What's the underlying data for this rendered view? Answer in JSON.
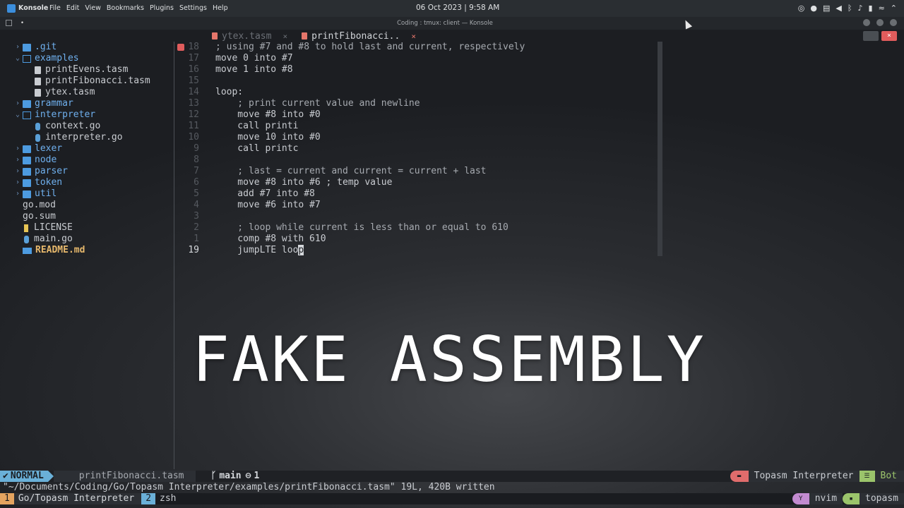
{
  "system_bar": {
    "app_name": "Konsole",
    "menus": [
      "File",
      "Edit",
      "View",
      "Bookmarks",
      "Plugins",
      "Settings",
      "Help"
    ],
    "clock": "06 Oct 2023 | 9:58 AM",
    "tray_icons": [
      "chromium-icon",
      "steam-icon",
      "clipboard-icon",
      "volume-icon",
      "bluetooth-icon",
      "microphone-icon",
      "battery-icon",
      "wifi-icon",
      "chevron-up-icon"
    ]
  },
  "window": {
    "dot": "•",
    "title": "Coding : tmux: client — Konsole"
  },
  "tabs": [
    {
      "label": "ytex.tasm",
      "close": "×",
      "active": false
    },
    {
      "label": "printFibonacci..",
      "close": "×",
      "active": true
    }
  ],
  "konsole_buttons": {
    "close": "×"
  },
  "tree": [
    {
      "name": ".git",
      "kind": "folder",
      "chev": "›",
      "indent": 0
    },
    {
      "name": "examples",
      "kind": "folder-open",
      "chev": "⌄",
      "indent": 0
    },
    {
      "name": "printEvens.tasm",
      "kind": "file",
      "indent": 1
    },
    {
      "name": "printFibonacci.tasm",
      "kind": "file",
      "indent": 1
    },
    {
      "name": "ytex.tasm",
      "kind": "file",
      "indent": 1
    },
    {
      "name": "grammar",
      "kind": "folder",
      "chev": "›",
      "indent": 0
    },
    {
      "name": "interpreter",
      "kind": "folder-open",
      "chev": "⌄",
      "indent": 0
    },
    {
      "name": "context.go",
      "kind": "go",
      "indent": 1
    },
    {
      "name": "interpreter.go",
      "kind": "go",
      "indent": 1
    },
    {
      "name": "lexer",
      "kind": "folder",
      "chev": "›",
      "indent": 0
    },
    {
      "name": "node",
      "kind": "folder",
      "chev": "›",
      "indent": 0
    },
    {
      "name": "parser",
      "kind": "folder",
      "chev": "›",
      "indent": 0
    },
    {
      "name": "token",
      "kind": "folder",
      "chev": "›",
      "indent": 0
    },
    {
      "name": "util",
      "kind": "folder",
      "chev": "›",
      "indent": 0
    },
    {
      "name": "go.mod",
      "kind": "plain",
      "indent": 0
    },
    {
      "name": "go.sum",
      "kind": "plain",
      "indent": 0
    },
    {
      "name": "LICENSE",
      "kind": "lic",
      "indent": 0
    },
    {
      "name": "main.go",
      "kind": "goroot",
      "indent": 0
    },
    {
      "name": "README.md",
      "kind": "md",
      "indent": 0
    }
  ],
  "editor_lines": [
    {
      "num": "18",
      "code": "; using #7 and #8 to hold last and current, respectively",
      "comment": true,
      "error": true
    },
    {
      "num": "17",
      "code": "move 0 into #7"
    },
    {
      "num": "16",
      "code": "move 1 into #8"
    },
    {
      "num": "15",
      "code": ""
    },
    {
      "num": "14",
      "code": "loop:"
    },
    {
      "num": "13",
      "code": "    ; print current value and newline",
      "comment": true
    },
    {
      "num": "12",
      "code": "    move #8 into #0"
    },
    {
      "num": "11",
      "code": "    call printi"
    },
    {
      "num": "10",
      "code": "    move 10 into #0"
    },
    {
      "num": "9",
      "code": "    call printc"
    },
    {
      "num": "8",
      "code": ""
    },
    {
      "num": "7",
      "code": "    ; last = current and current = current + last",
      "comment": true
    },
    {
      "num": "6",
      "code": "    move #8 into #6 ; temp value"
    },
    {
      "num": "5",
      "code": "    add #7 into #8"
    },
    {
      "num": "4",
      "code": "    move #6 into #7"
    },
    {
      "num": "3",
      "code": ""
    },
    {
      "num": "2",
      "code": "    ; loop while current is less than or equal to 610",
      "comment": true
    },
    {
      "num": "1",
      "code": "    comp #8 with 610"
    },
    {
      "num": "19",
      "code": "    jumpLTE loo",
      "cursor_char": "p",
      "current": true
    }
  ],
  "overlay_text": "FAKE ASSEMBLY",
  "statusline": {
    "mode": "NORMAL",
    "file": "printFibonacci.tasm",
    "branch_icon": "ᚴ",
    "branch": "main",
    "diag_icon": "⊖",
    "diag_count": "1",
    "project_icon": "▬",
    "project": "Topasm Interpreter",
    "position_icon": "☰",
    "position": "Bot"
  },
  "cmdline": "\"~/Documents/Coding/Go/Topasm Interpreter/examples/printFibonacci.tasm\" 19L, 420B written",
  "tmux": {
    "windows": [
      {
        "index": "1",
        "name": "Go/Topasm Interpreter",
        "active": true
      },
      {
        "index": "2",
        "name": "zsh",
        "active": false
      }
    ],
    "right": [
      {
        "icon": "Y",
        "text": "nvim"
      },
      {
        "icon": "▪",
        "text": "topasm"
      }
    ]
  }
}
